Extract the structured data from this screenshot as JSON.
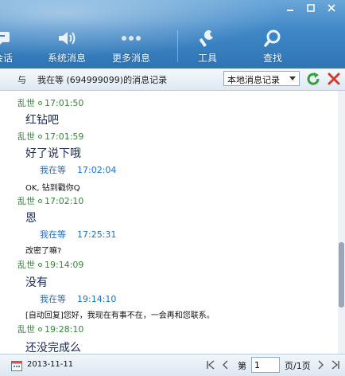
{
  "toolbar": {
    "items": [
      {
        "label": "会话",
        "icon": "chat-icon"
      },
      {
        "label": "系统消息",
        "icon": "speaker-icon"
      },
      {
        "label": "更多消息",
        "icon": "more-icon"
      },
      {
        "label": "工具",
        "icon": "wrench-icon"
      },
      {
        "label": "查找",
        "icon": "search-icon"
      }
    ]
  },
  "header": {
    "prefix": "与",
    "contact": "我在等",
    "contact_id": "(694999099)的消息记录",
    "source_select": "本地消息记录"
  },
  "messages": [
    {
      "sender": "乱世",
      "time": "17:01:50",
      "text": "红钻吧",
      "self": false
    },
    {
      "sender": "乱世",
      "time": "17:01:59",
      "text": "好了说下哦",
      "self": false
    },
    {
      "sender": "我在等",
      "time": "17:02:04",
      "text": "OK, 钻到戳你Q",
      "self": true
    },
    {
      "sender": "乱世",
      "time": "17:02:10",
      "text": "恩",
      "self": false
    },
    {
      "sender": "我在等",
      "time": "17:25:31",
      "text": "改密了嘛?",
      "self": true
    },
    {
      "sender": "乱世",
      "time": "19:14:09",
      "text": "没有",
      "self": false
    },
    {
      "sender": "我在等",
      "time": "19:14:10",
      "text": "[自动回复]您好，我现在有事不在，一会再和您联系。",
      "self": true
    },
    {
      "sender": "乱世",
      "time": "19:28:10",
      "text": "还没完成么",
      "self": false
    }
  ],
  "footer": {
    "date": "2013-11-11",
    "page_prefix": "第",
    "page_value": "1",
    "page_suffix": "页/1页"
  },
  "colors": {
    "other_sender": "#2e8b34",
    "self_sender": "#1c6fd1",
    "toolbar": "#3f87c6"
  }
}
